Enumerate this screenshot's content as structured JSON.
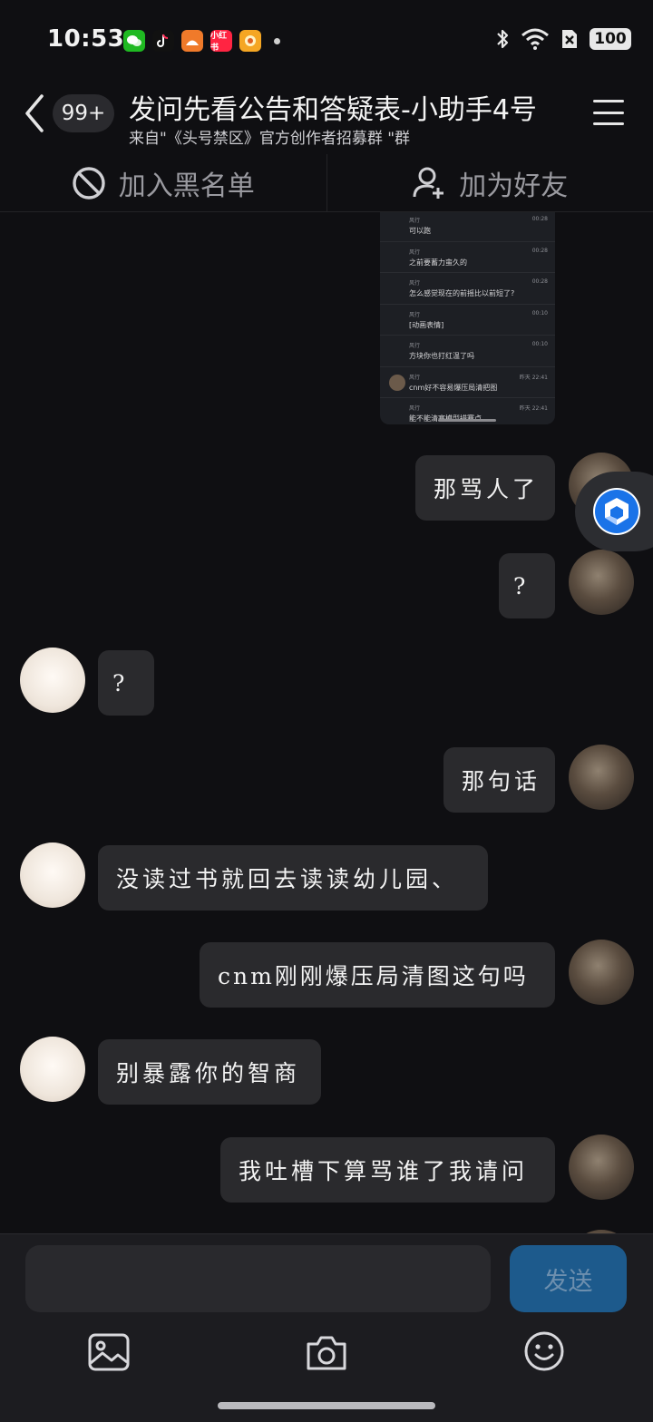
{
  "status_bar": {
    "time": "10:53",
    "battery": "100",
    "app_icons": [
      {
        "name": "wechat-icon",
        "color": "#1fb922",
        "label": ""
      },
      {
        "name": "tiktok-icon",
        "color": "#111111",
        "label": ""
      },
      {
        "name": "app-orange-icon",
        "color": "#f07a2a",
        "label": ""
      },
      {
        "name": "xiaohongshu-icon",
        "color": "#ff2442",
        "label": "小红书"
      },
      {
        "name": "app-yellow-icon",
        "color": "#f5a623",
        "label": ""
      }
    ]
  },
  "header": {
    "unread_badge": "99+",
    "title": "发问先看公告和答疑表-小助手4号",
    "subtitle": "来自\"《头号禁区》官方创作者招募群 \"群"
  },
  "actions": {
    "blacklist": "加入黑名单",
    "add_friend": "加为好友"
  },
  "screenshot_preview": {
    "rows": [
      {
        "name": "风行",
        "time": "00:28",
        "text": "可以跑",
        "avatar": false
      },
      {
        "name": "风行",
        "time": "00:28",
        "text": "之前要蓄力蛮久的",
        "avatar": false
      },
      {
        "name": "风行",
        "time": "00:28",
        "text": "怎么感觉现在的前摇比以前短了?",
        "avatar": false
      },
      {
        "name": "风行",
        "time": "00:10",
        "text": "[动画表情]",
        "avatar": false
      },
      {
        "name": "风行",
        "time": "00:10",
        "text": "方块你也打红温了吗",
        "avatar": false
      },
      {
        "name": "风行",
        "time": "昨天 22:41",
        "text": "cnm好不容易爆压局清把图",
        "avatar": true
      },
      {
        "name": "风行",
        "time": "昨天 22:41",
        "text": "能不能清塞模型措赛点",
        "avatar": false
      }
    ]
  },
  "messages": [
    {
      "side": "right",
      "text": "那骂人了"
    },
    {
      "side": "right",
      "text": "?"
    },
    {
      "side": "left",
      "text": "?"
    },
    {
      "side": "right",
      "text": "那句话"
    },
    {
      "side": "left",
      "text": "没读过书就回去读读幼儿园、"
    },
    {
      "side": "right",
      "text": "cnm刚刚爆压局清图这句吗"
    },
    {
      "side": "left",
      "text": "别暴露你的智商"
    },
    {
      "side": "right",
      "text": "我吐槽下算骂谁了我请问"
    }
  ],
  "input": {
    "value": "",
    "placeholder": "",
    "send_label": "发送"
  },
  "colors": {
    "background": "#0f0f12",
    "bubble": "#2a2a2d",
    "send_button": "#1d5a8c",
    "assistant_blue": "#1a73e8"
  }
}
